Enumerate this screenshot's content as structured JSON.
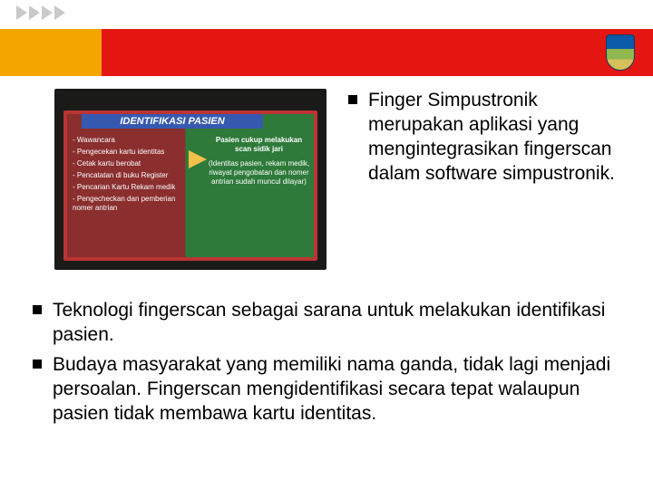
{
  "slide_thumb": {
    "title": "IDENTIFIKASI PASIEN",
    "left_items": [
      "- Wawancara",
      "- Pengecekan kartu identitas",
      "- Cetak kartu berobat",
      "- Pencatatan di buku Register",
      "- Pencarian Kartu Rekam medik",
      "- Pengecheckan dan pemberian nomer antrian"
    ],
    "right_header": "Pasien cukup melakukan scan sidik jari",
    "right_note": "(Identitas pasien, rekam medik, riwayat pengobatan dan nomer antrian sudah muncul dilayar)"
  },
  "bullets_top": [
    "Finger Simpustronik merupakan aplikasi yang mengintegrasikan fingerscan dalam software simpustronik."
  ],
  "bullets_bottom": [
    "Teknologi fingerscan sebagai sarana untuk melakukan identifikasi pasien.",
    "Budaya masyarakat yang memiliki nama ganda, tidak lagi menjadi persoalan. Fingerscan mengidentifikasi secara tepat walaupun pasien tidak membawa kartu identitas."
  ]
}
